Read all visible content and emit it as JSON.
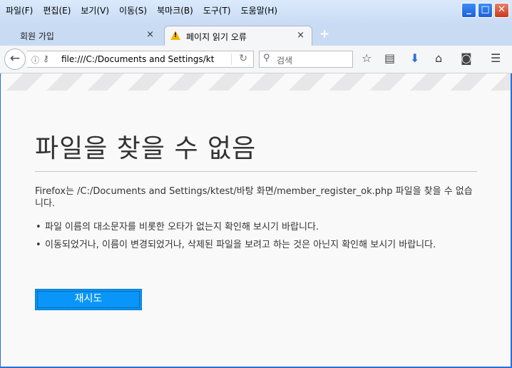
{
  "menu": [
    "파일(F)",
    "편집(E)",
    "보기(V)",
    "이동(S)",
    "북마크(B)",
    "도구(T)",
    "도움말(H)"
  ],
  "tabs": [
    {
      "label": "회원 가입",
      "close": "×"
    },
    {
      "label": "페이지 읽기 오류",
      "close": "×"
    }
  ],
  "new_tab": "+",
  "url": "file:///C:/Documents and Settings/kt",
  "search_placeholder": "검색",
  "error": {
    "title": "파일을 찾을 수 없음",
    "description": "Firefox는 /C:/Documents and Settings/ktest/바탕 화면/member_register_ok.php 파일을 찾을 수 없습니다.",
    "bullets": [
      "파일 이름의 대소문자를 비롯한 오타가 없는지 확인해 보시기 바랍니다.",
      "이동되었거나, 이름이 변경되었거나, 삭제된 파일을 보려고 하는 것은 아닌지 확인해 보시기 바랍니다."
    ],
    "retry": "재시도"
  },
  "colors": {
    "accent": "#0996f8",
    "titlebar": "#2a6fd6",
    "warning": "#f2b705"
  }
}
